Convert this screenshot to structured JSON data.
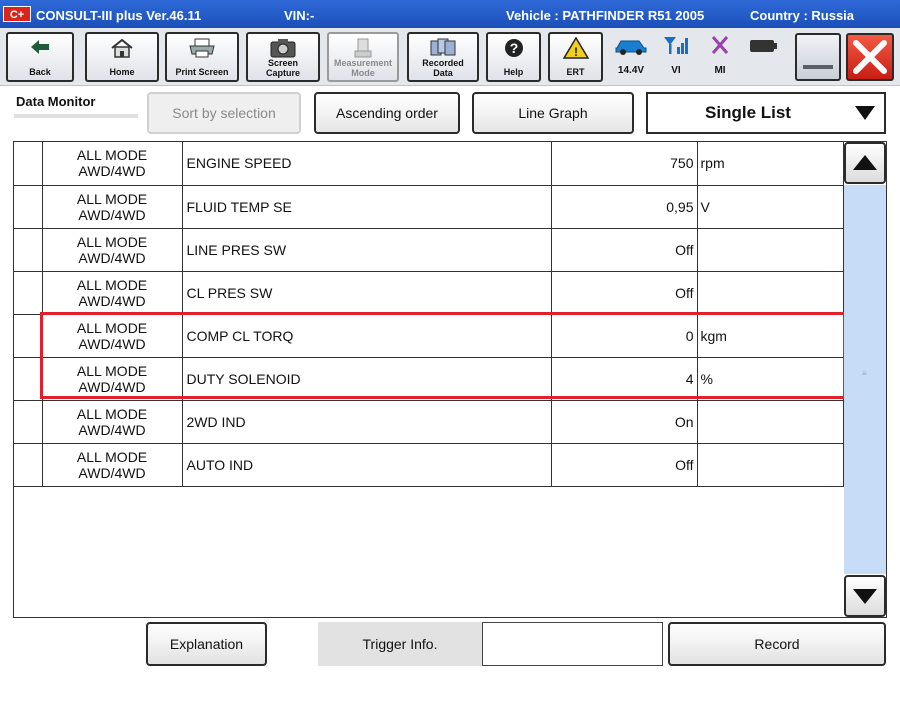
{
  "titlebar": {
    "app": "CONSULT-III plus  Ver.46.11",
    "vin": "VIN:-",
    "vehicle": "Vehicle : PATHFINDER R51 2005",
    "country": "Country : Russia",
    "logo": "C+"
  },
  "toolbar": {
    "back": "Back",
    "home": "Home",
    "print_screen": "Print Screen",
    "screen_capture_1": "Screen",
    "screen_capture_2": "Capture",
    "measurement_1": "Measurement",
    "measurement_2": "Mode",
    "recorded_1": "Recorded",
    "recorded_2": "Data",
    "help": "Help",
    "ert": "ERT",
    "battery_voltage": "14.4V",
    "vi": "VI",
    "mi": "MI"
  },
  "panel": {
    "title": "Data Monitor",
    "sort_by_selection": "Sort by selection",
    "ascending_order": "Ascending order",
    "line_graph": "Line Graph",
    "view_mode": "Single List"
  },
  "rows": [
    {
      "mode1": "ALL MODE",
      "mode2": "AWD/4WD",
      "item": "ENGINE SPEED",
      "value": "750",
      "unit": "rpm"
    },
    {
      "mode1": "ALL MODE",
      "mode2": "AWD/4WD",
      "item": "FLUID TEMP SE",
      "value": "0,95",
      "unit": "V"
    },
    {
      "mode1": "ALL MODE",
      "mode2": "AWD/4WD",
      "item": "LINE PRES SW",
      "value": "Off",
      "unit": ""
    },
    {
      "mode1": "ALL MODE",
      "mode2": "AWD/4WD",
      "item": "CL PRES SW",
      "value": "Off",
      "unit": ""
    },
    {
      "mode1": "ALL MODE",
      "mode2": "AWD/4WD",
      "item": "COMP CL TORQ",
      "value": "0",
      "unit": "kgm"
    },
    {
      "mode1": "ALL MODE",
      "mode2": "AWD/4WD",
      "item": "DUTY SOLENOID",
      "value": "4",
      "unit": "%"
    },
    {
      "mode1": "ALL MODE",
      "mode2": "AWD/4WD",
      "item": "2WD IND",
      "value": "On",
      "unit": ""
    },
    {
      "mode1": "ALL MODE",
      "mode2": "AWD/4WD",
      "item": "AUTO IND",
      "value": "Off",
      "unit": ""
    }
  ],
  "bottom": {
    "explanation": "Explanation",
    "trigger_info": "Trigger Info.",
    "trigger_value": "",
    "record": "Record"
  },
  "colors": {
    "titlebar": "#1b4fb8",
    "highlight": "#e0202c",
    "scroll_track": "#c7dcf6",
    "close_button": "#c81e12"
  }
}
